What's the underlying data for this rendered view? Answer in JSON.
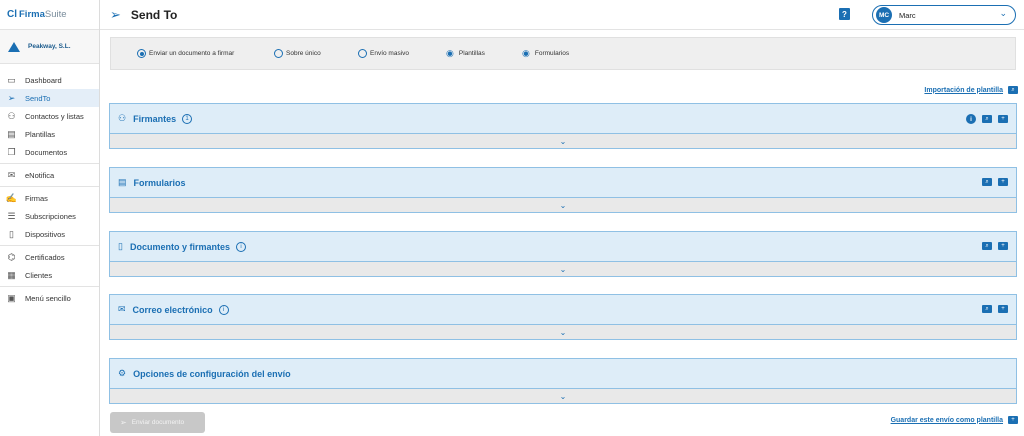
{
  "brand": {
    "logo_mark": "Cl",
    "name_bold": "Firma",
    "name_light": "Suite"
  },
  "company": {
    "name": "Peakway, S.L."
  },
  "sidebar": {
    "items": [
      {
        "label": "Dashboard",
        "icon": "dashboard-icon"
      },
      {
        "label": "SendTo",
        "icon": "send-icon",
        "active": true
      },
      {
        "label": "Contactos y listas",
        "icon": "contacts-icon"
      },
      {
        "label": "Plantillas",
        "icon": "templates-icon"
      },
      {
        "label": "Documentos",
        "icon": "documents-icon"
      },
      {
        "label": "eNotifica",
        "icon": "enotifica-icon"
      },
      {
        "label": "Firmas",
        "icon": "signature-icon"
      },
      {
        "label": "Subscripciones",
        "icon": "subscriptions-icon"
      },
      {
        "label": "Dispositivos",
        "icon": "devices-icon"
      },
      {
        "label": "Certificados",
        "icon": "certificates-icon"
      },
      {
        "label": "Clientes",
        "icon": "clients-icon"
      },
      {
        "label": "Menú sencillo",
        "icon": "simple-menu-icon"
      }
    ]
  },
  "header": {
    "title": "Send To",
    "help_label": "?",
    "user": {
      "initials": "MC",
      "name": "Marc"
    }
  },
  "options": {
    "items": [
      {
        "label": "Enviar un documento a firmar",
        "selected": true
      },
      {
        "label": "Sobre único",
        "selected": false
      },
      {
        "label": "Envío masivo",
        "selected": false
      },
      {
        "label": "Plantillas"
      },
      {
        "label": "Formularios"
      }
    ]
  },
  "import_link": "Importación de plantilla",
  "sections": [
    {
      "title": "Firmantes",
      "badge": "1"
    },
    {
      "title": "Formularios"
    },
    {
      "title": "Documento y firmantes",
      "badge": "i"
    },
    {
      "title": "Correo electrónico",
      "badge": "i"
    },
    {
      "title": "Opciones de configuración del envío"
    }
  ],
  "footer": {
    "send_button": "Enviar documento",
    "save_link": "Guardar este envío como plantilla"
  },
  "colors": {
    "accent": "#1b6fb3",
    "section_bg": "#deedf8",
    "active_nav_bg": "#e4eef8"
  }
}
